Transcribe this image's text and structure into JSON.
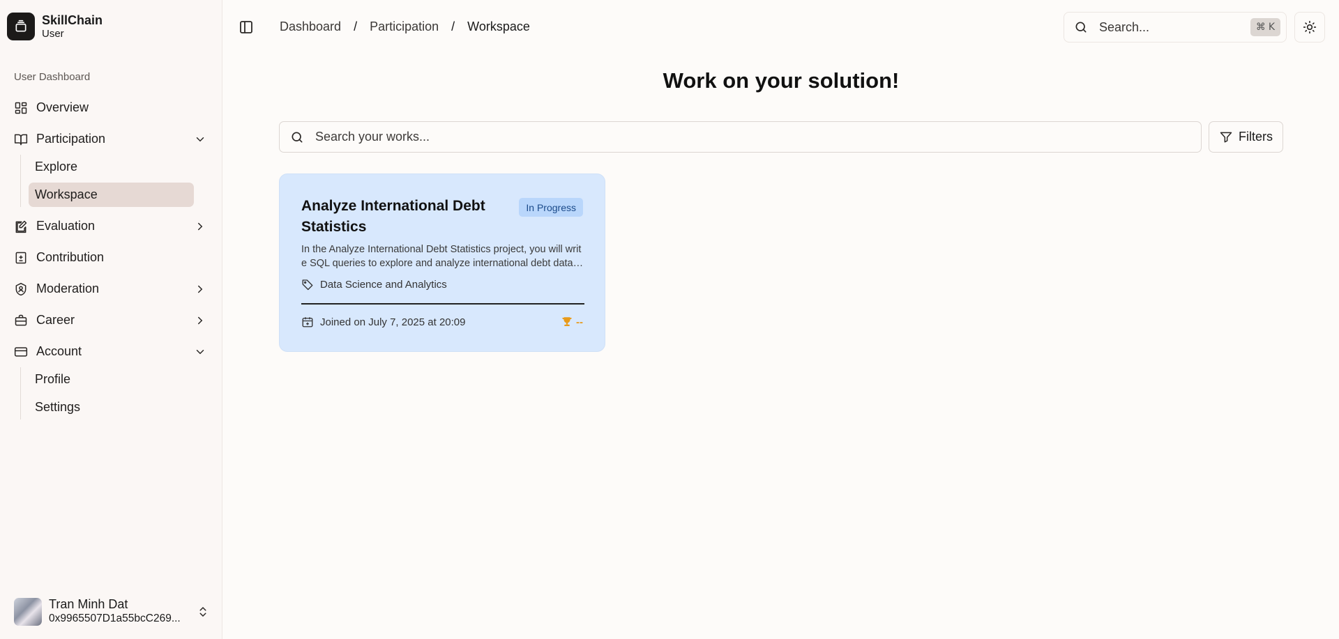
{
  "brand": {
    "name": "SkillChain",
    "role": "User"
  },
  "sidebar": {
    "group_label": "User Dashboard",
    "overview": "Overview",
    "participation": {
      "label": "Participation",
      "sub": [
        "Explore",
        "Workspace"
      ]
    },
    "evaluation": "Evaluation",
    "contribution": "Contribution",
    "moderation": "Moderation",
    "career": "Career",
    "account": {
      "label": "Account",
      "sub": [
        "Profile",
        "Settings"
      ]
    }
  },
  "user": {
    "name": "Tran Minh Dat",
    "address": "0x9965507D1a55bcC269..."
  },
  "header": {
    "breadcrumb": [
      "Dashboard",
      "Participation",
      "Workspace"
    ],
    "separator": "/",
    "search_placeholder": "Search...",
    "shortcut_symbol": "⌘",
    "shortcut_key": "K"
  },
  "main": {
    "title": "Work on your solution!",
    "search_placeholder": "Search your works...",
    "filters_label": "Filters"
  },
  "cards": [
    {
      "title": "Analyze International Debt Statistics",
      "status": "In Progress",
      "description": "In the Analyze International Debt Statistics project, you will write SQL queries to explore and analyze international debt data provided by The World Bank.",
      "category": "Data Science and Analytics",
      "joined": "Joined on July 7, 2025 at 20:09",
      "score": "--"
    }
  ],
  "colors": {
    "accent_active": "#e6d9d4",
    "card_bg": "#d8e8fd",
    "badge_bg": "#b9d6fb",
    "trophy": "#e89a1a"
  }
}
